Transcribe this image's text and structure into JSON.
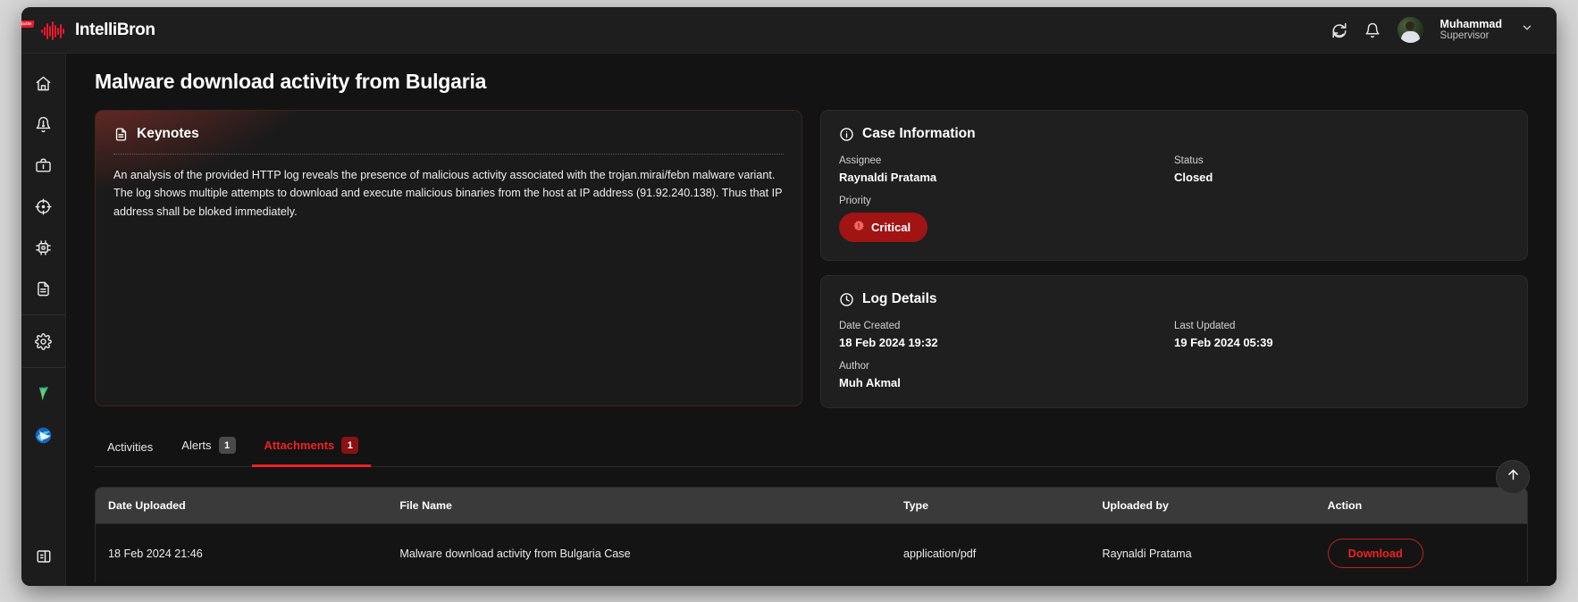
{
  "brand": {
    "name": "IntelliBron",
    "badge": "SOC Suite",
    "logo_icon": "waveform-icon"
  },
  "header": {
    "refresh_icon": "refresh-icon",
    "bell_icon": "bell-icon",
    "avatar_icon": "avatar",
    "user_name": "Muhammad",
    "user_role": "Supervisor",
    "chevron_icon": "chevron-down-icon"
  },
  "sidebar": {
    "items": [
      {
        "icon": "home-icon",
        "name": "home"
      },
      {
        "icon": "bell-alert-icon",
        "name": "alerts"
      },
      {
        "icon": "briefcase-icon",
        "name": "cases"
      },
      {
        "icon": "target-icon",
        "name": "threat-hunting"
      },
      {
        "icon": "cpu-chip-icon",
        "name": "assets"
      },
      {
        "icon": "document-icon",
        "name": "reports"
      },
      {
        "icon": "gear-icon",
        "name": "settings"
      },
      {
        "icon": "app-teal-icon",
        "name": "app-teal"
      },
      {
        "icon": "app-blue-icon",
        "name": "app-blue"
      },
      {
        "icon": "panel-toggle-icon",
        "name": "collapse-sidebar"
      }
    ]
  },
  "page": {
    "title": "Malware download activity from Bulgaria"
  },
  "keynotes": {
    "icon": "document-icon",
    "title": "Keynotes",
    "body": "An analysis of the provided HTTP log reveals the presence of malicious activity associated with the trojan.mirai/febn malware variant. The log shows multiple attempts to download and execute malicious binaries from the host at IP address (91.92.240.138). Thus that IP address shall be bloked immediately."
  },
  "case_information": {
    "icon": "info-circle-icon",
    "title": "Case Information",
    "assignee_label": "Assignee",
    "assignee_value": "Raynaldi Pratama",
    "status_label": "Status",
    "status_value": "Closed",
    "priority_label": "Priority",
    "priority_value": "Critical",
    "priority_icon": "alert-burst-icon",
    "priority_color": "#a01414"
  },
  "log_details": {
    "icon": "clock-icon",
    "title": "Log Details",
    "date_created_label": "Date Created",
    "date_created_value": "18 Feb 2024 19:32",
    "last_updated_label": "Last Updated",
    "last_updated_value": "19 Feb 2024 05:39",
    "author_label": "Author",
    "author_value": "Muh Akmal"
  },
  "tabs": [
    {
      "label": "Activities",
      "badge": "",
      "active": false
    },
    {
      "label": "Alerts",
      "badge": "1",
      "active": false
    },
    {
      "label": "Attachments",
      "badge": "1",
      "active": true
    }
  ],
  "attachments_table": {
    "columns": [
      "Date Uploaded",
      "File Name",
      "Type",
      "Uploaded by",
      "Action"
    ],
    "rows": [
      {
        "date_uploaded": "18 Feb 2024 21:46",
        "file_name": "Malware download activity from Bulgaria Case",
        "type": "application/pdf",
        "uploaded_by": "Raynaldi Pratama",
        "action_label": "Download"
      }
    ]
  },
  "fab": {
    "icon": "arrow-up-icon"
  },
  "colors": {
    "accent_red": "#ef2222",
    "badge_red": "#8a1111",
    "critical_red": "#a01414"
  }
}
